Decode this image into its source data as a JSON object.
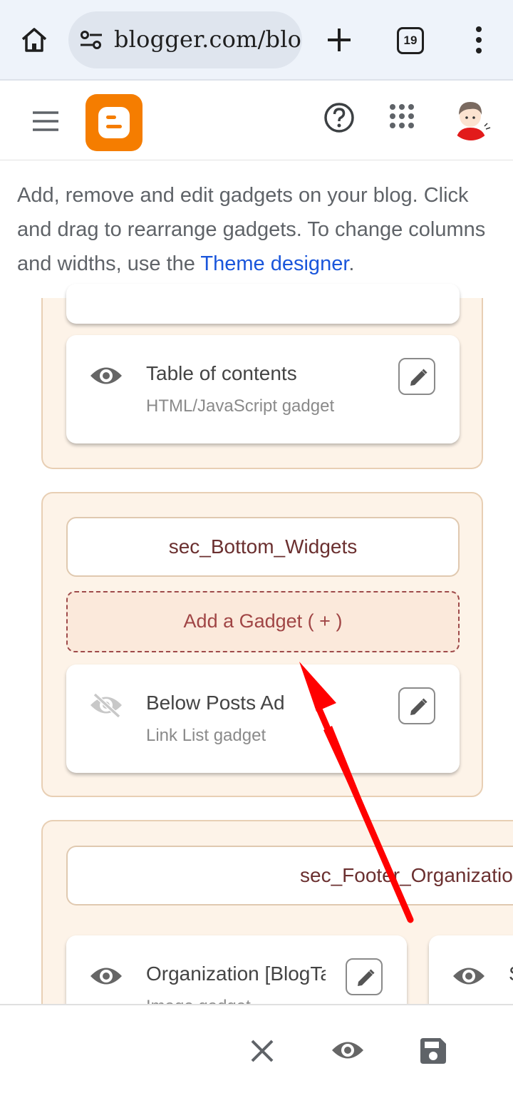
{
  "browser": {
    "url": "blogger.com/blog",
    "tab_count": "19"
  },
  "intro": {
    "text": "Add, remove and edit gadgets on your blog. Click and drag to rearrange gadgets. To change columns and widths, use the ",
    "link": "Theme designer",
    "end": "."
  },
  "sections": {
    "top": {
      "gadget": {
        "title": "Table of contents",
        "type": "HTML/JavaScript gadget",
        "icon": "eye-icon"
      }
    },
    "bottom_widgets": {
      "header": "sec_Bottom_Widgets",
      "add_label": "Add a Gadget ( + )",
      "gadget": {
        "title": "Below Posts Ad",
        "type": "Link List gadget",
        "icon": "eye-off-icon"
      }
    },
    "footer": {
      "header": "sec_Footer_Organization",
      "gadget1": {
        "title": "Organization [BlogTag]",
        "type": "Image gadget",
        "icon": "eye-icon"
      },
      "gadget2": {
        "title": "S",
        "icon": "eye-icon"
      }
    }
  },
  "colors": {
    "blogger_orange": "#f57d00",
    "section_bg": "#fdf3e8",
    "annotation_arrow": "#ff0000",
    "link": "#1a56db"
  }
}
